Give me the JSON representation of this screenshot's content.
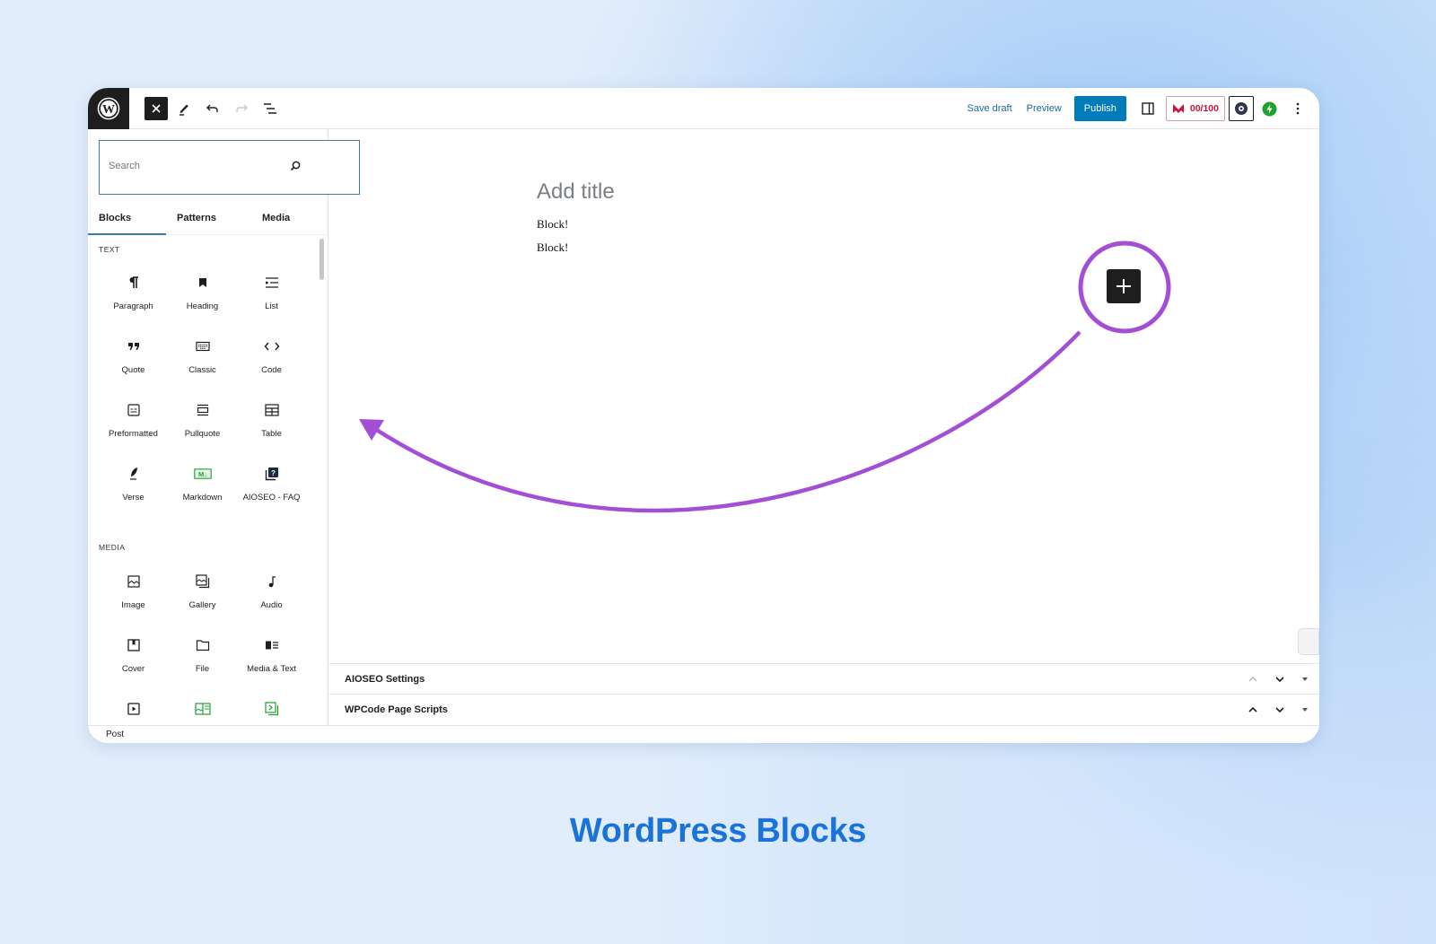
{
  "caption": "WordPress Blocks",
  "colors": {
    "accent": "#007cba",
    "annotation": "#a24fd6",
    "caption": "#1a73d9",
    "score": "#c8143c",
    "green": "#1fa12e"
  },
  "toolbar": {
    "logo_icon": "wordpress-logo-icon",
    "close_icon": "close-icon",
    "tools_icon": "pencil-icon",
    "undo_icon": "undo-icon",
    "redo_icon": "redo-icon",
    "outline_icon": "document-overview-icon",
    "save_draft": "Save draft",
    "preview": "Preview",
    "publish": "Publish",
    "score": "00/100",
    "settings_icon": "sidebar-toggle-icon",
    "options_icon": "more-vertical-icon"
  },
  "inserter": {
    "search": {
      "value": "",
      "placeholder": "Search"
    },
    "tabs": [
      {
        "label": "Blocks",
        "active": true
      },
      {
        "label": "Patterns",
        "active": false
      },
      {
        "label": "Media",
        "active": false
      }
    ],
    "sections": [
      {
        "label": "TEXT",
        "blocks": [
          {
            "label": "Paragraph",
            "icon": "paragraph-icon"
          },
          {
            "label": "Heading",
            "icon": "bookmark-icon"
          },
          {
            "label": "List",
            "icon": "list-icon"
          },
          {
            "label": "Quote",
            "icon": "quote-icon"
          },
          {
            "label": "Classic",
            "icon": "keyboard-icon"
          },
          {
            "label": "Code",
            "icon": "code-icon"
          },
          {
            "label": "Preformatted",
            "icon": "preformatted-icon"
          },
          {
            "label": "Pullquote",
            "icon": "pullquote-icon"
          },
          {
            "label": "Table",
            "icon": "table-icon"
          },
          {
            "label": "Verse",
            "icon": "feather-icon"
          },
          {
            "label": "Markdown",
            "icon": "markdown-icon"
          },
          {
            "label": "AIOSEO - FAQ",
            "icon": "faq-icon"
          }
        ]
      },
      {
        "label": "MEDIA",
        "blocks": [
          {
            "label": "Image",
            "icon": "image-icon"
          },
          {
            "label": "Gallery",
            "icon": "gallery-icon"
          },
          {
            "label": "Audio",
            "icon": "audio-icon"
          },
          {
            "label": "Cover",
            "icon": "cover-icon"
          },
          {
            "label": "File",
            "icon": "folder-icon"
          },
          {
            "label": "Media & Text",
            "icon": "media-text-icon"
          },
          {
            "label": "",
            "icon": "video-icon"
          },
          {
            "label": "",
            "icon": "green-gallery-icon"
          },
          {
            "label": "",
            "icon": "green-embed-icon"
          }
        ]
      }
    ]
  },
  "editor": {
    "title_placeholder": "Add title",
    "paragraphs": [
      "Block!",
      "Block!"
    ]
  },
  "meta_boxes": [
    {
      "title": "AIOSEO Settings"
    },
    {
      "title": "WPCode Page Scripts"
    }
  ],
  "status_bar": {
    "breadcrumb": "Post"
  },
  "annotation": {
    "highlight": "block-inserter-button",
    "arrow_points_to": "block-inserter-panel"
  }
}
